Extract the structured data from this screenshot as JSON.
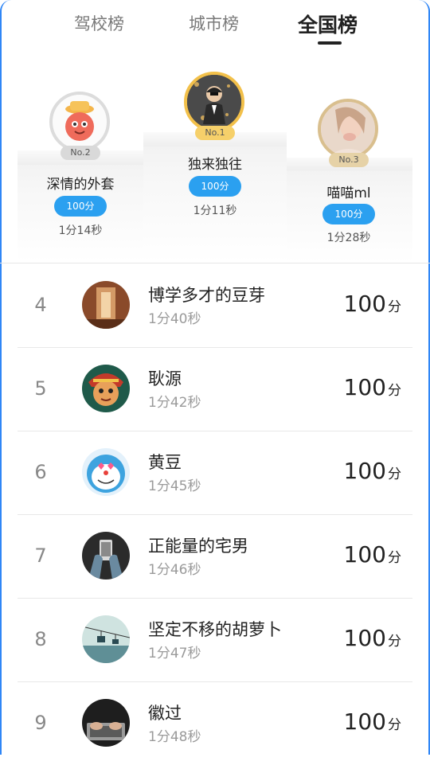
{
  "tabs": [
    {
      "label": "驾校榜",
      "active": false
    },
    {
      "label": "城市榜",
      "active": false
    },
    {
      "label": "全国榜",
      "active": true
    }
  ],
  "podium": [
    {
      "position": 1,
      "badge": "No.1",
      "name": "独来独往",
      "score": "100分",
      "time": "1分11秒",
      "badge_color": "#f6d06a",
      "ring_color": "#f2c04a",
      "avatar": "man-in-suit-avatar"
    },
    {
      "position": 2,
      "badge": "No.2",
      "name": "深情的外套",
      "score": "100分",
      "time": "1分14秒",
      "badge_color": "#d9d9d9",
      "ring_color": "#dcdcdc",
      "avatar": "cartoon-mascot-avatar"
    },
    {
      "position": 3,
      "badge": "No.3",
      "name": "喵喵ml",
      "score": "100分",
      "time": "1分28秒",
      "badge_color": "#e6d2a7",
      "ring_color": "#d9bf8e",
      "avatar": "portrait-photo-avatar"
    }
  ],
  "list": [
    {
      "rank": "4",
      "name": "博学多才的豆芽",
      "time": "1分40秒",
      "score": "100",
      "unit": "分",
      "avatar": "hallway-photo-avatar"
    },
    {
      "rank": "5",
      "name": "耿源",
      "time": "1分42秒",
      "score": "100",
      "unit": "分",
      "avatar": "monkey-king-avatar"
    },
    {
      "rank": "6",
      "name": "黄豆",
      "time": "1分45秒",
      "score": "100",
      "unit": "分",
      "avatar": "doraemon-avatar"
    },
    {
      "rank": "7",
      "name": "正能量的宅男",
      "time": "1分46秒",
      "score": "100",
      "unit": "分",
      "avatar": "phone-hands-avatar"
    },
    {
      "rank": "8",
      "name": "坚定不移的胡萝卜",
      "time": "1分47秒",
      "score": "100",
      "unit": "分",
      "avatar": "cable-car-avatar"
    },
    {
      "rank": "9",
      "name": "徽过",
      "time": "1分48秒",
      "score": "100",
      "unit": "分",
      "avatar": "laptop-typing-avatar"
    }
  ],
  "colors": {
    "accent": "#2ba0f0",
    "frame": "#2f86f6"
  }
}
